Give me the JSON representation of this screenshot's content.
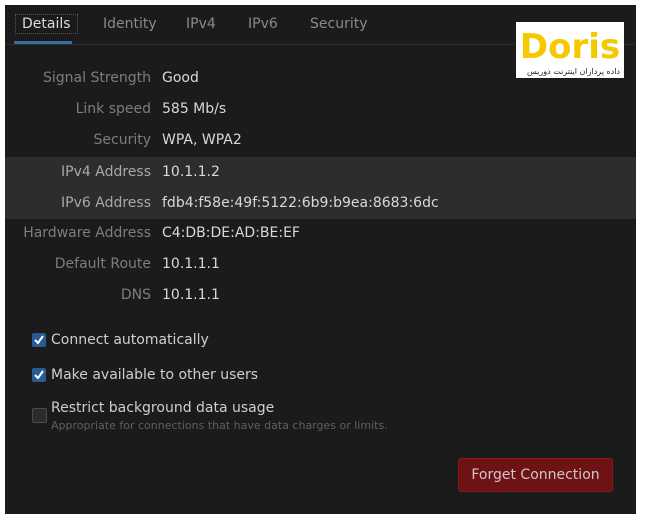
{
  "tabs": [
    {
      "label": "Details",
      "active": true
    },
    {
      "label": "Identity"
    },
    {
      "label": "IPv4"
    },
    {
      "label": "IPv6"
    },
    {
      "label": "Security"
    }
  ],
  "logo": {
    "text": "Doris",
    "subtitle": "داده پردازان اینترنت دوریس",
    "color": "#f6c800"
  },
  "details": [
    {
      "label": "Signal Strength",
      "value": "Good"
    },
    {
      "label": "Link speed",
      "value": "585 Mb/s"
    },
    {
      "label": "Security",
      "value": "WPA, WPA2"
    },
    {
      "label": "IPv4 Address",
      "value": "10.1.1.2"
    },
    {
      "label": "IPv6 Address",
      "value": "fdb4:f58e:49f:5122:6b9:b9ea:8683:6dc"
    },
    {
      "label": "Hardware Address",
      "value": "C4:DB:DE:AD:BE:EF"
    },
    {
      "label": "Default Route",
      "value": "10.1.1.1"
    },
    {
      "label": "DNS",
      "value": "10.1.1.1"
    }
  ],
  "options": [
    {
      "label": "Connect automatically",
      "checked": true
    },
    {
      "label": "Make available to other users",
      "checked": true
    },
    {
      "label": "Restrict background data usage",
      "checked": false,
      "description": "Appropriate for connections that have data charges or limits."
    }
  ],
  "forget_button": "Forget Connection",
  "colors": {
    "accent": "#2a5a94",
    "destructive": "#6e1216"
  }
}
